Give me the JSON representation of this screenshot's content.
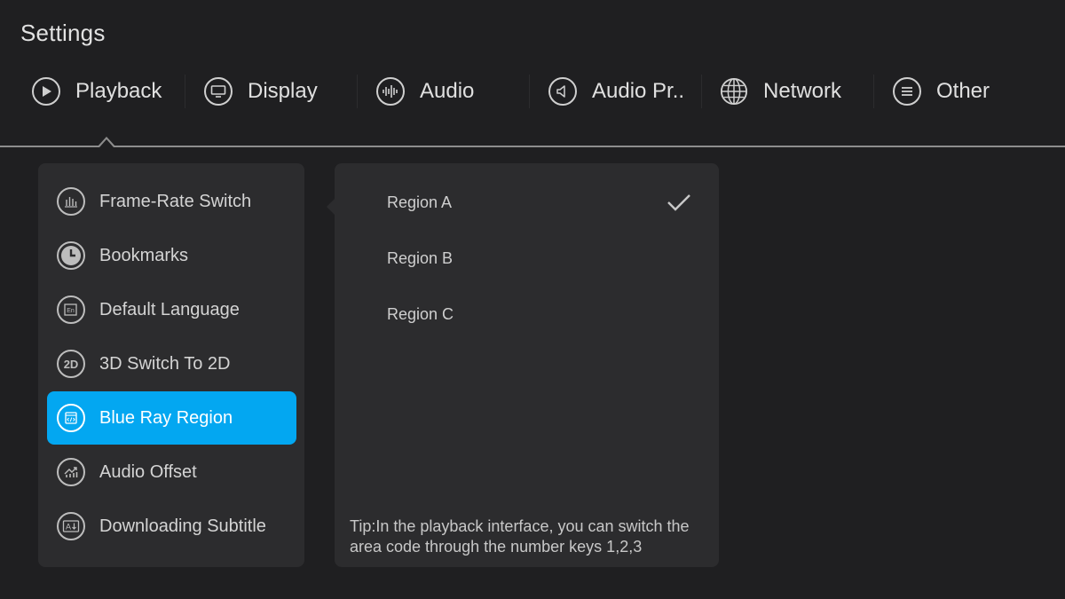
{
  "title": "Settings",
  "tabs": [
    {
      "label": "Playback",
      "icon": "play-icon"
    },
    {
      "label": "Display",
      "icon": "monitor-icon"
    },
    {
      "label": "Audio",
      "icon": "equalizer-icon"
    },
    {
      "label": "Audio Pr..",
      "icon": "speaker-icon"
    },
    {
      "label": "Network",
      "icon": "globe-icon"
    },
    {
      "label": "Other",
      "icon": "menu-icon"
    }
  ],
  "active_tab": "Playback",
  "menu": {
    "items": [
      {
        "label": "Frame-Rate Switch",
        "icon": "bar-chart-icon"
      },
      {
        "label": "Bookmarks",
        "icon": "clock-icon"
      },
      {
        "label": "Default Language",
        "icon": "language-icon"
      },
      {
        "label": "3D Switch To 2D",
        "icon": "2d-icon"
      },
      {
        "label": "Blue Ray Region",
        "icon": "disc-code-icon"
      },
      {
        "label": "Audio Offset",
        "icon": "audio-offset-icon"
      },
      {
        "label": "Downloading Subtitle",
        "icon": "subtitle-download-icon"
      }
    ],
    "active_item": "Blue Ray Region"
  },
  "options": {
    "items": [
      {
        "label": "Region A",
        "selected": true
      },
      {
        "label": "Region B",
        "selected": false
      },
      {
        "label": "Region C",
        "selected": false
      }
    ],
    "tip": "Tip:In the playback interface, you can switch the area code through the number keys 1,2,3"
  },
  "colors": {
    "background": "#1f1f21",
    "panel": "#2c2c2e",
    "accent": "#03a7f1",
    "text": "#d6d6d6"
  }
}
